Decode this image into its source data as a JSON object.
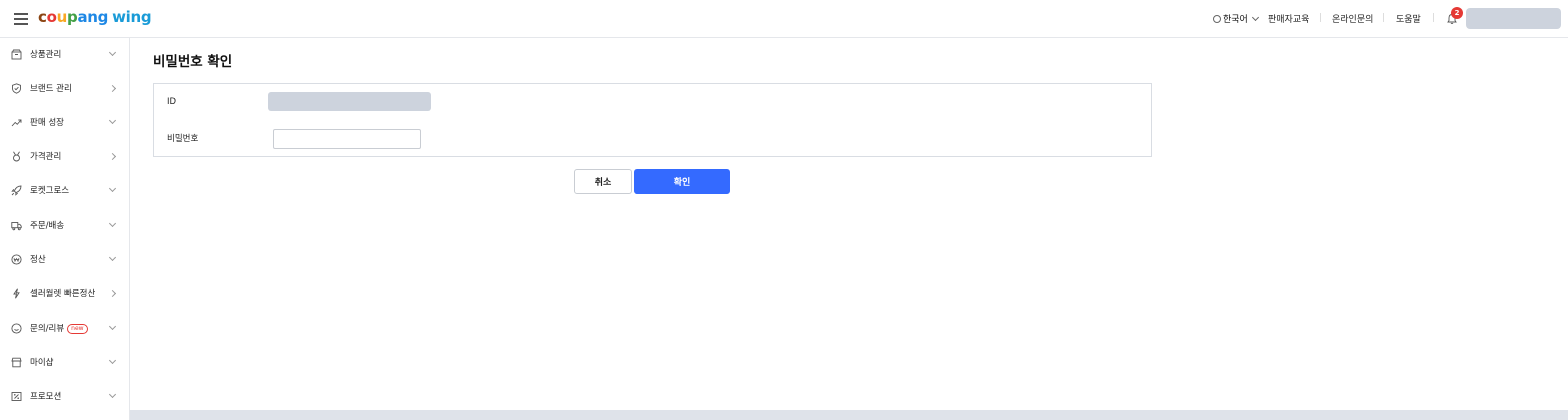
{
  "brand": {
    "logo_parts": [
      "c",
      "o",
      "u",
      "p",
      "ang"
    ],
    "logo_suffix": "wing"
  },
  "header": {
    "language": "한국어",
    "links": [
      "판매자교육",
      "온라인문의",
      "도움말"
    ],
    "notification_count": "2"
  },
  "sidebar": {
    "items": [
      {
        "label": "상품관리",
        "icon": "box-icon",
        "arrow": "down"
      },
      {
        "label": "브랜드 관리",
        "icon": "shield-check-icon",
        "arrow": "right"
      },
      {
        "label": "판매 성장",
        "icon": "trend-up-icon",
        "arrow": "down"
      },
      {
        "label": "가격관리",
        "icon": "medal-icon",
        "arrow": "right"
      },
      {
        "label": "로켓그로스",
        "icon": "rocket-icon",
        "arrow": "down"
      },
      {
        "label": "주문/배송",
        "icon": "truck-icon",
        "arrow": "down"
      },
      {
        "label": "정산",
        "icon": "won-coin-icon",
        "arrow": "down"
      },
      {
        "label": "셀러월렛 빠른정산",
        "icon": "lightning-icon",
        "arrow": "right"
      },
      {
        "label": "문의/리뷰",
        "icon": "smile-icon",
        "arrow": "down",
        "badge": "new"
      },
      {
        "label": "마이샵",
        "icon": "shop-icon",
        "arrow": "down"
      },
      {
        "label": "프로모션",
        "icon": "coupon-icon",
        "arrow": "down"
      }
    ]
  },
  "main": {
    "title": "비밀번호 확인",
    "id_label": "ID",
    "password_label": "비밀번호",
    "password_value": "",
    "cancel_label": "취소",
    "confirm_label": "확인"
  },
  "colors": {
    "accent": "#346aff",
    "badge": "#e53935",
    "redacted": "#cdd3dd"
  }
}
